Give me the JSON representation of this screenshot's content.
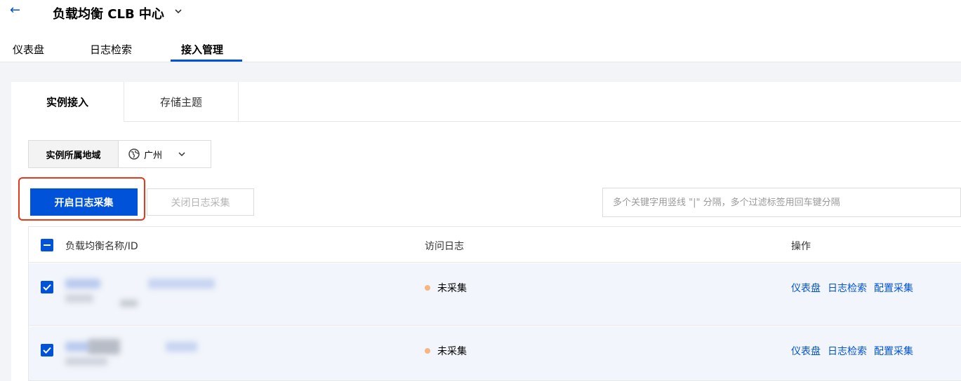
{
  "header": {
    "back_icon": "arrow-left-icon",
    "title": "负载均衡 CLB 中心",
    "nav_tabs": [
      {
        "label": "仪表盘"
      },
      {
        "label": "日志检索"
      },
      {
        "label": "接入管理",
        "active": true
      }
    ]
  },
  "subtabs": [
    {
      "label": "实例接入",
      "active": true
    },
    {
      "label": "存储主题"
    }
  ],
  "region": {
    "label": "实例所属地域",
    "value": "广州",
    "icon": "globe-icon"
  },
  "toolbar": {
    "enable_label": "开启日志采集",
    "disable_label": "关闭日志采集",
    "search_placeholder": "多个关键字用竖线 \"|\" 分隔，多个过滤标签用回车键分隔"
  },
  "table": {
    "columns": [
      "负载均衡名称/ID",
      "访问日志",
      "操作"
    ],
    "rows": [
      {
        "status": "未采集",
        "actions": [
          "仪表盘",
          "日志检索",
          "配置采集"
        ]
      },
      {
        "status": "未采集",
        "actions": [
          "仪表盘",
          "日志检索",
          "配置采集"
        ]
      }
    ]
  },
  "colors": {
    "primary": "#0052d9",
    "highlight": "#e8381a",
    "status_dot": "#f6b67f"
  }
}
